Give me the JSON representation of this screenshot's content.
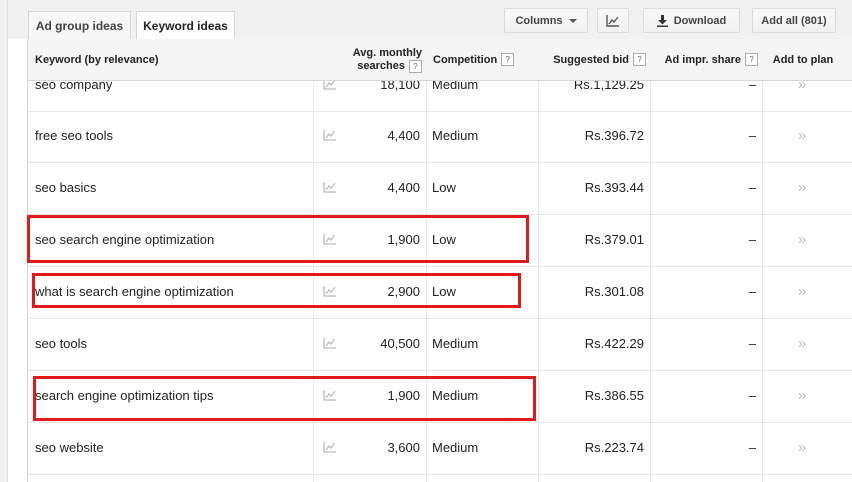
{
  "tabs": [
    {
      "label": "Ad group ideas",
      "active": false
    },
    {
      "label": "Keyword ideas",
      "active": true
    }
  ],
  "toolbar": {
    "columns_label": "Columns",
    "chart_icon": "line-chart-icon",
    "download_label": "Download",
    "add_all_label": "Add all (801)"
  },
  "table": {
    "headers": {
      "keyword": "Keyword (by relevance)",
      "searches_line1": "Avg. monthly",
      "searches_line2": "searches",
      "competition": "Competition",
      "bid": "Suggested bid",
      "share": "Ad impr. share",
      "add": "Add to plan",
      "help_glyph": "?"
    },
    "add_glyph": "»",
    "rows": [
      {
        "keyword": "seo company",
        "searches": "18,100",
        "competition": "Medium",
        "bid": "Rs.1,129.25",
        "share": "–"
      },
      {
        "keyword": "free seo tools",
        "searches": "4,400",
        "competition": "Medium",
        "bid": "Rs.396.72",
        "share": "–"
      },
      {
        "keyword": "seo basics",
        "searches": "4,400",
        "competition": "Low",
        "bid": "Rs.393.44",
        "share": "–"
      },
      {
        "keyword": "seo search engine optimization",
        "searches": "1,900",
        "competition": "Low",
        "bid": "Rs.379.01",
        "share": "–"
      },
      {
        "keyword": "what is search engine optimization",
        "searches": "2,900",
        "competition": "Low",
        "bid": "Rs.301.08",
        "share": "–"
      },
      {
        "keyword": "seo tools",
        "searches": "40,500",
        "competition": "Medium",
        "bid": "Rs.422.29",
        "share": "–"
      },
      {
        "keyword": "search engine optimization tips",
        "searches": "1,900",
        "competition": "Medium",
        "bid": "Rs.386.55",
        "share": "–"
      },
      {
        "keyword": "seo website",
        "searches": "3,600",
        "competition": "Medium",
        "bid": "Rs.223.74",
        "share": "–"
      }
    ]
  },
  "highlight_color": "#e01b1b"
}
